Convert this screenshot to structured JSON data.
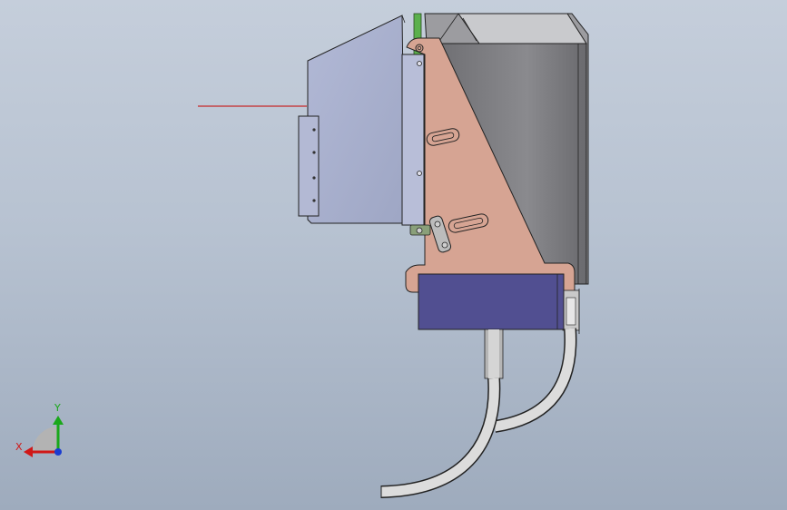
{
  "viewport": {
    "background": "#b9c4d3"
  },
  "triad": {
    "x_label": "X",
    "y_label": "Y",
    "colors": {
      "x": "#d01818",
      "y": "#1aa81a",
      "z": "#1a3cd0"
    }
  },
  "model": {
    "components": [
      "sight-line",
      "cover-plate",
      "mounting-bracket",
      "slotted-adjust-plate",
      "camera-housing",
      "sensor-body",
      "cable-primary",
      "cable-secondary"
    ],
    "colors": {
      "cover_plate": "#a7afcc",
      "bracket": "#d6a493",
      "housing_dark": "#7c7c80",
      "sensor_body": "#514f91",
      "green_rail": "#5bb04c",
      "cable": "#d7d7d7",
      "sight_line": "#c62828"
    }
  }
}
